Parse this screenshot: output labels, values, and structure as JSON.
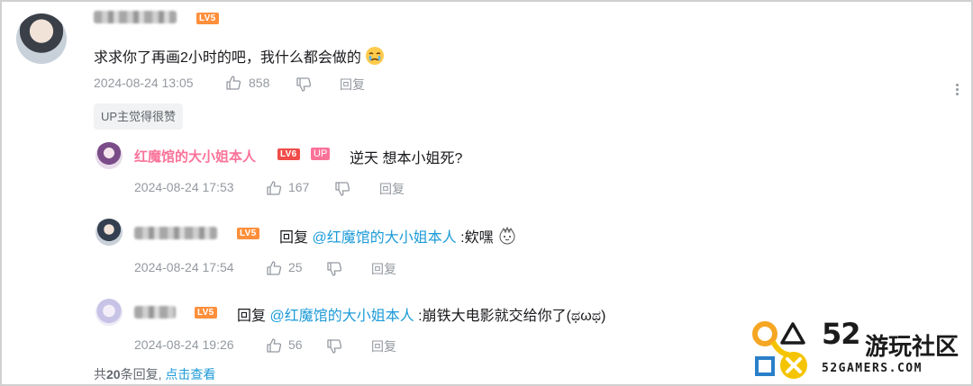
{
  "main_comment": {
    "user_level": "LV5",
    "text": "求求你了再画2小时的吧，我什么都会做的",
    "time": "2024-08-24 13:05",
    "likes": "858",
    "reply_label": "回复",
    "up_tag": "UP主觉得很赞"
  },
  "replies": [
    {
      "username": "红魔馆的大小姐本人",
      "level": "LV6",
      "up_badge": "UP",
      "text": "逆天 想本小姐死?",
      "time": "2024-08-24 17:53",
      "likes": "167",
      "reply_label": "回复"
    },
    {
      "level": "LV5",
      "prefix": "回复 ",
      "mention": "@红魔馆的大小姐本人",
      "text": " :欸嘿",
      "time": "2024-08-24 17:54",
      "likes": "25",
      "reply_label": "回复"
    },
    {
      "level": "LV5",
      "prefix": "回复 ",
      "mention": "@红魔馆的大小姐本人",
      "text": " :崩铁大电影就交给你了(ಥωಥ)",
      "time": "2024-08-24 19:26",
      "likes": "56",
      "reply_label": "回复"
    }
  ],
  "summary": {
    "prefix": "共",
    "count": "20",
    "suffix": "条回复,",
    "link": "点击查看"
  },
  "watermark": {
    "number": "52",
    "name_cn": "游玩社区",
    "domain": "52GAMERS.COM"
  },
  "colors": {
    "up_pink": "#fb7299",
    "mention_blue": "#1d9bd8",
    "meta_gray": "#9499a0",
    "level5_orange": "#ff8f3a",
    "level6_red": "#f04c49"
  }
}
